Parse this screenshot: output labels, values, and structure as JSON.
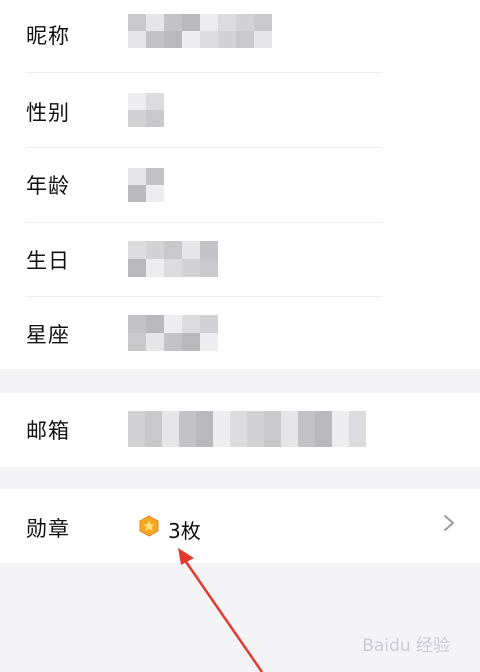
{
  "profile": {
    "fields": [
      {
        "label": "昵称"
      },
      {
        "label": "性别"
      },
      {
        "label": "年龄"
      },
      {
        "label": "生日"
      },
      {
        "label": "星座"
      },
      {
        "label": "邮箱"
      }
    ],
    "medal": {
      "label": "勋章",
      "value": "3枚",
      "icon": "medal-icon"
    }
  },
  "icons": {
    "chevron": "chevron-right-icon",
    "arrow": "annotation-arrow"
  },
  "watermark": "Baidu 经验",
  "colors": {
    "background": "#ffffff",
    "separator": "#f4f4f6",
    "medal_orange": "#f5a623",
    "arrow_red": "#e23b2e"
  }
}
